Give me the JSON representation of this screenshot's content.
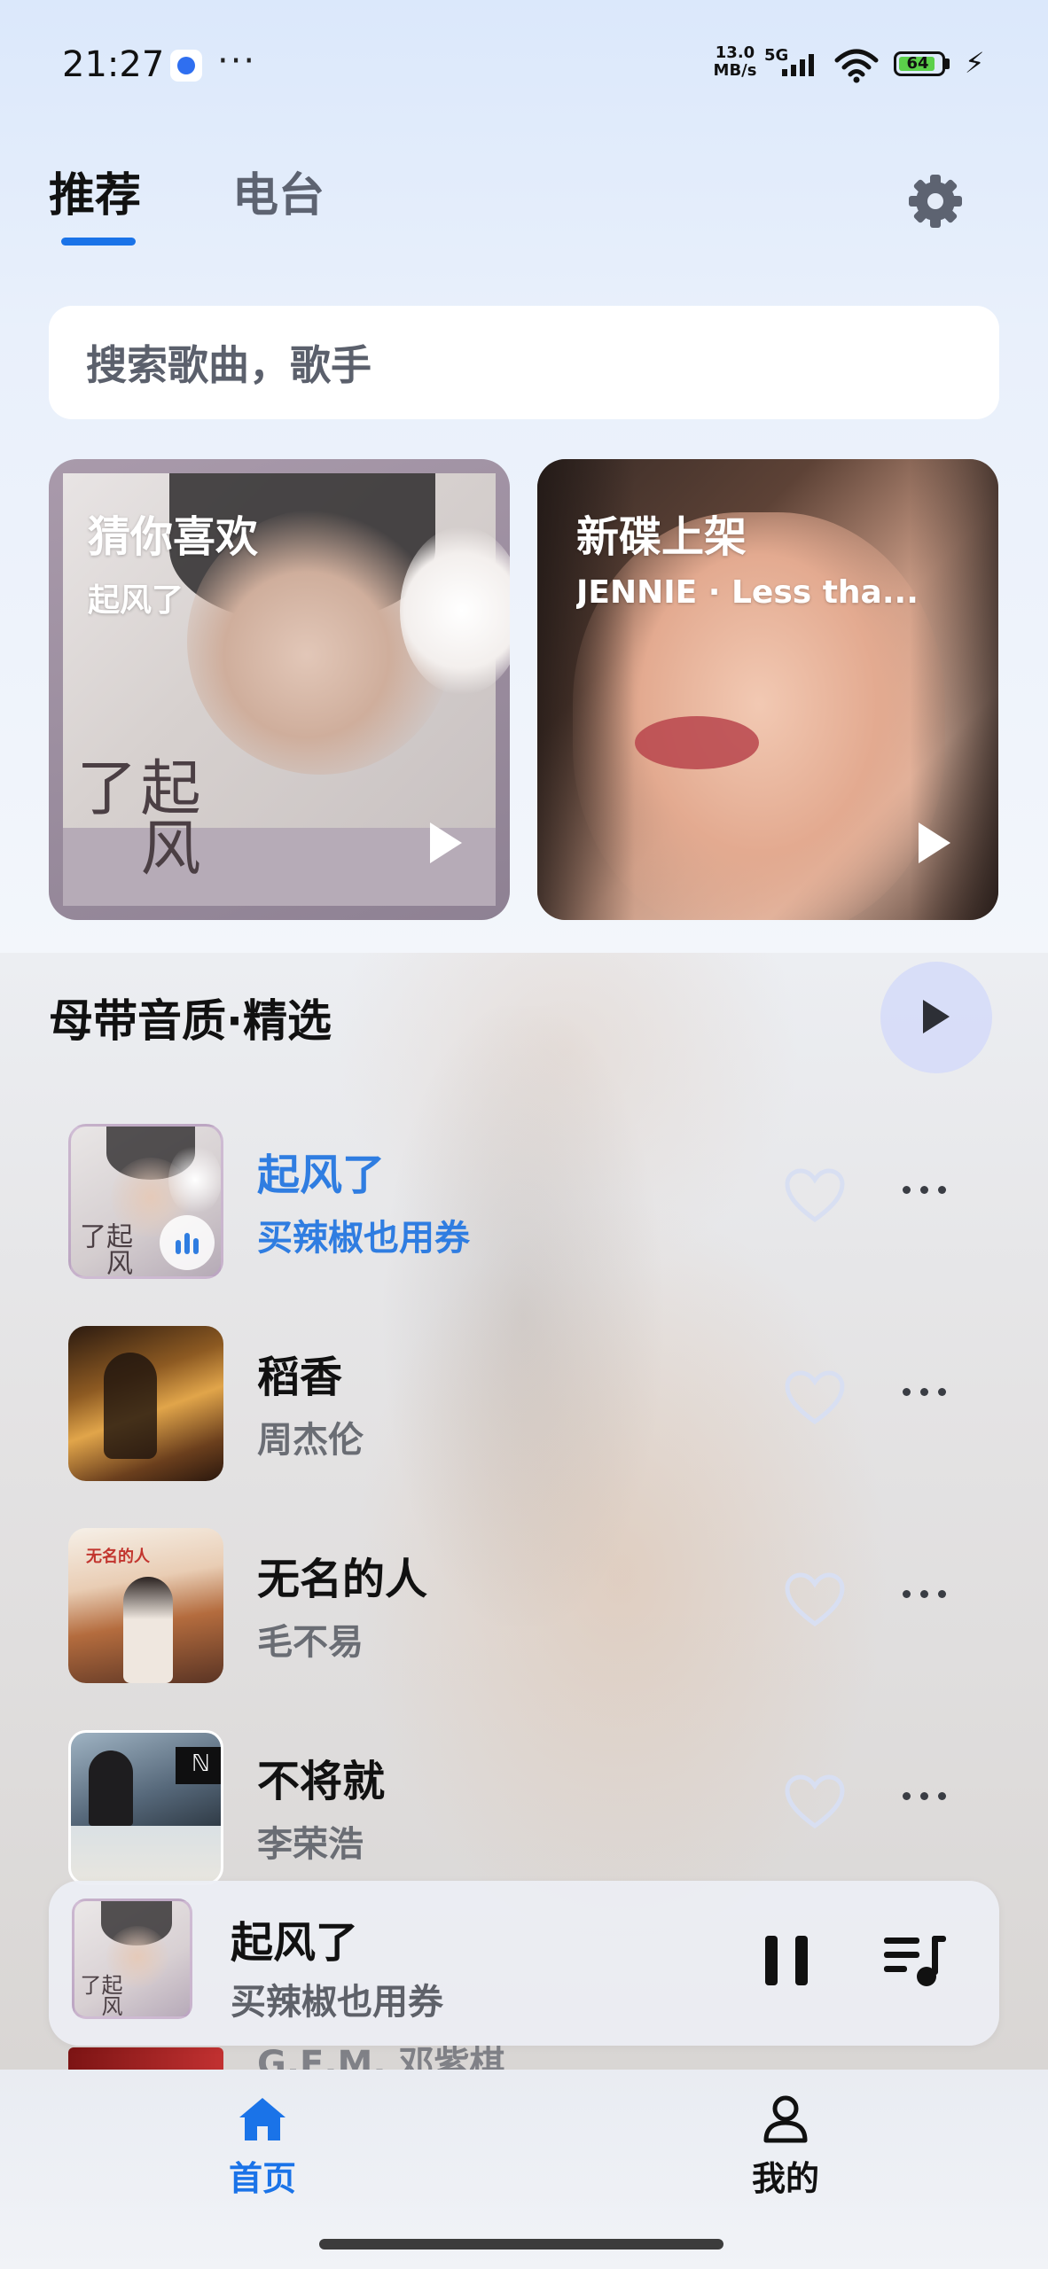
{
  "status_bar": {
    "time": "21:27",
    "net_speed_value": "13.0",
    "net_speed_unit": "MB/s",
    "network_type": "5G",
    "battery": "64"
  },
  "header": {
    "tabs": [
      {
        "label": "推荐",
        "active": true
      },
      {
        "label": "电台",
        "active": false
      }
    ]
  },
  "search": {
    "placeholder": "搜索歌曲，歌手"
  },
  "feature_cards": [
    {
      "title": "猜你喜欢",
      "subtitle": "起风了",
      "cover_text": "起风了"
    },
    {
      "title": "新碟上架",
      "subtitle": "JENNIE · Less tha..."
    }
  ],
  "section": {
    "title": "母带音质·精选",
    "songs": [
      {
        "title": "起风了",
        "artist": "买辣椒也用券",
        "playing": true,
        "cover_text": "起风了"
      },
      {
        "title": "稻香",
        "artist": "周杰伦",
        "playing": false
      },
      {
        "title": "无名的人",
        "artist": "毛不易",
        "playing": false,
        "cover_text": "无名的人"
      },
      {
        "title": "不将就",
        "artist": "李荣浩",
        "playing": false
      }
    ],
    "peek_artist": "G.E.M. 邓紫棋"
  },
  "mini_player": {
    "title": "起风了",
    "artist": "买辣椒也用券",
    "cover_text": "起风了",
    "state": "playing"
  },
  "bottom_nav": {
    "items": [
      {
        "label": "首页",
        "icon": "home-icon",
        "active": true
      },
      {
        "label": "我的",
        "icon": "person-icon",
        "active": false
      }
    ]
  },
  "colors": {
    "accent": "#1a73e8",
    "playing_text": "#2f7de1"
  }
}
